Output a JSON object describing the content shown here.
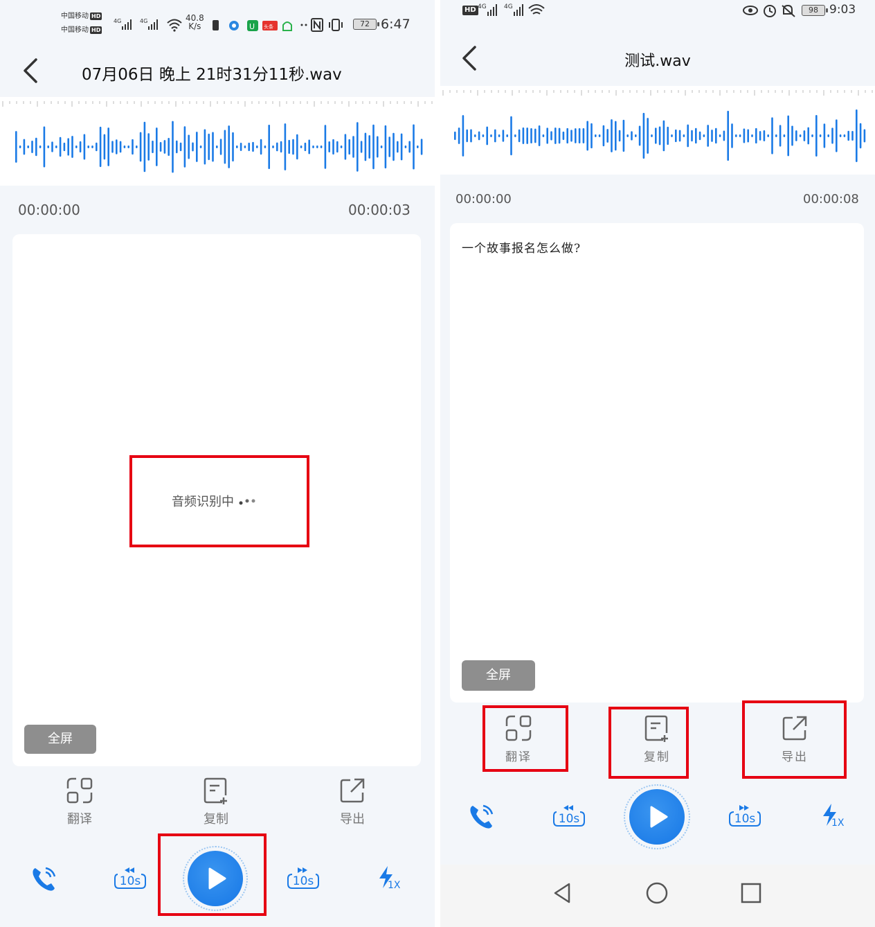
{
  "colors": {
    "accent": "#1a7ae6",
    "highlight": "#e60012",
    "wave": "#1a7ae6"
  },
  "left": {
    "status": {
      "carrier1": "中国移动",
      "carrier2": "中国移动",
      "hd": "HD",
      "net": "4G",
      "speed_value": "40.8",
      "speed_unit": "K/s",
      "app_badge": "头条",
      "battery": "72",
      "time": "6:47"
    },
    "header": {
      "title": "07月06日 晚上 21时31分11秒.wav"
    },
    "times": {
      "start": "00:00:00",
      "end": "00:00:03"
    },
    "card": {
      "loading_text": "音频识别中"
    },
    "fullscreen_label": "全屏",
    "actions": {
      "translate": "翻译",
      "copy": "复制",
      "export": "导出"
    },
    "player": {
      "rewind_label": "10s",
      "forward_label": "10s",
      "speed_label": "1X"
    }
  },
  "right": {
    "status": {
      "hd": "HD",
      "net": "4G",
      "battery": "98",
      "time": "9:03"
    },
    "header": {
      "title": "测试.wav"
    },
    "times": {
      "start": "00:00:00",
      "end": "00:00:08"
    },
    "card": {
      "transcript": "一个故事报名怎么做?"
    },
    "fullscreen_label": "全屏",
    "actions": {
      "translate": "翻译",
      "copy": "复制",
      "export": "导出"
    },
    "player": {
      "rewind_label": "10s",
      "forward_label": "10s",
      "speed_label": "1X"
    }
  }
}
